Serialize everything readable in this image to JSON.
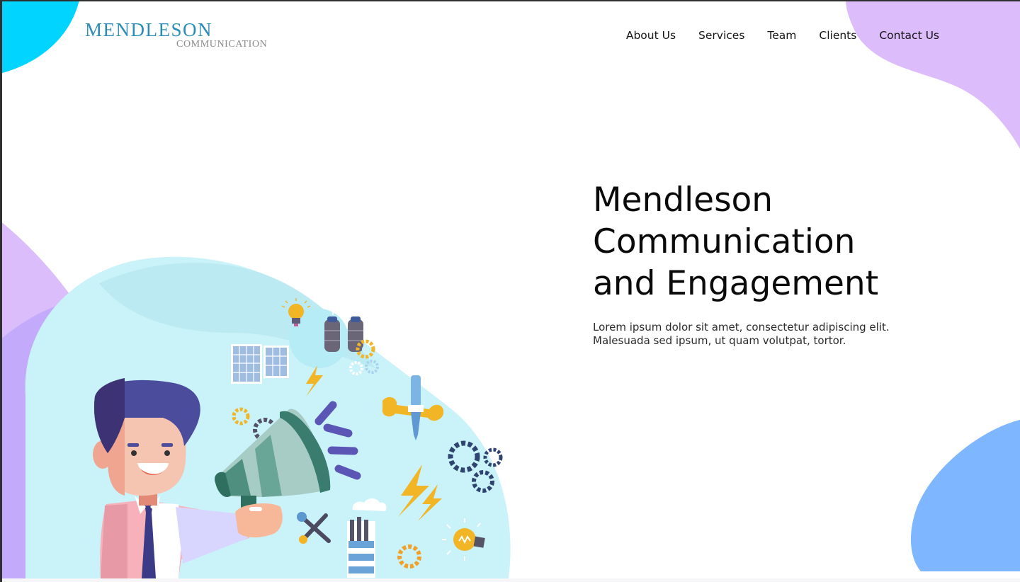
{
  "brand": {
    "name": "MENDLESON",
    "tagline": "COMMUNICATION"
  },
  "nav": {
    "items": [
      {
        "label": "About Us"
      },
      {
        "label": "Services"
      },
      {
        "label": "Team"
      },
      {
        "label": "Clients"
      },
      {
        "label": "Contact Us"
      }
    ]
  },
  "hero": {
    "title_line1": "Mendleson",
    "title_line2": "Communication",
    "title_line3": "and Engagement",
    "description_line1": "Lorem ipsum dolor sit amet, consectetur adipiscing elit.",
    "description_line2": "Malesuada sed ipsum, ut quam volutpat, tortor."
  },
  "theme": {
    "cyan_blob": "#00d4ff",
    "lavender_blob": "#d9b8fb",
    "purple_blob": "#c4a8fa",
    "blue_blob": "#7eb6ff",
    "illustration_bg": "#c8f1f8",
    "logo_blue": "#2a8cb7"
  },
  "illustration": {
    "subject": "man with megaphone",
    "icons": [
      "light-bulb-icon",
      "gas-cylinder-icon",
      "solar-panel-icon",
      "gear-icon",
      "lightning-icon",
      "wrench-screwdriver-icon",
      "tools-icon",
      "factory-icon",
      "cloud-icon"
    ]
  }
}
